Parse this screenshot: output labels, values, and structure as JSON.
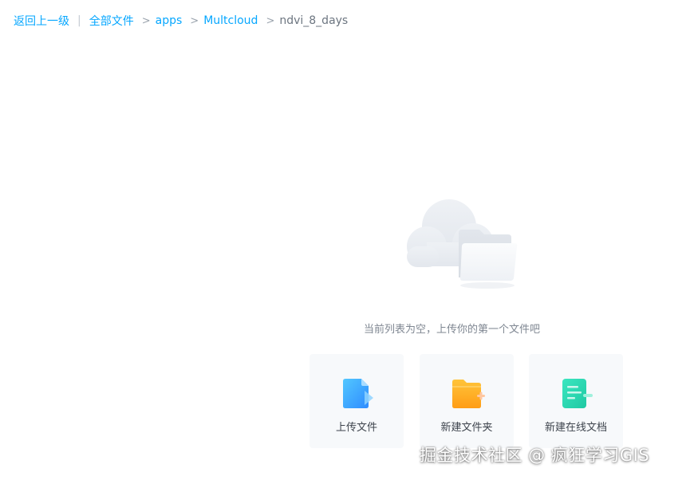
{
  "breadcrumb": {
    "back_label": "返回上一级",
    "items": [
      {
        "label": "全部文件"
      },
      {
        "label": "apps"
      },
      {
        "label": "Multcloud"
      }
    ],
    "current": "ndvi_8_days"
  },
  "empty_state": {
    "message": "当前列表为空，上传你的第一个文件吧",
    "icon": "cloud-folder-icon"
  },
  "actions": [
    {
      "label": "上传文件",
      "icon": "upload-file-icon",
      "color": "#3aa8ff"
    },
    {
      "label": "新建文件夹",
      "icon": "new-folder-icon",
      "color": "#ffb224"
    },
    {
      "label": "新建在线文档",
      "icon": "online-doc-icon",
      "color": "#2dd8b0"
    }
  ],
  "watermark": "掘金技术社区 @ 疯狂学习GIS",
  "colors": {
    "link": "#06a7ff",
    "text_muted": "#7f8792",
    "card_bg": "#f7f9fb"
  }
}
